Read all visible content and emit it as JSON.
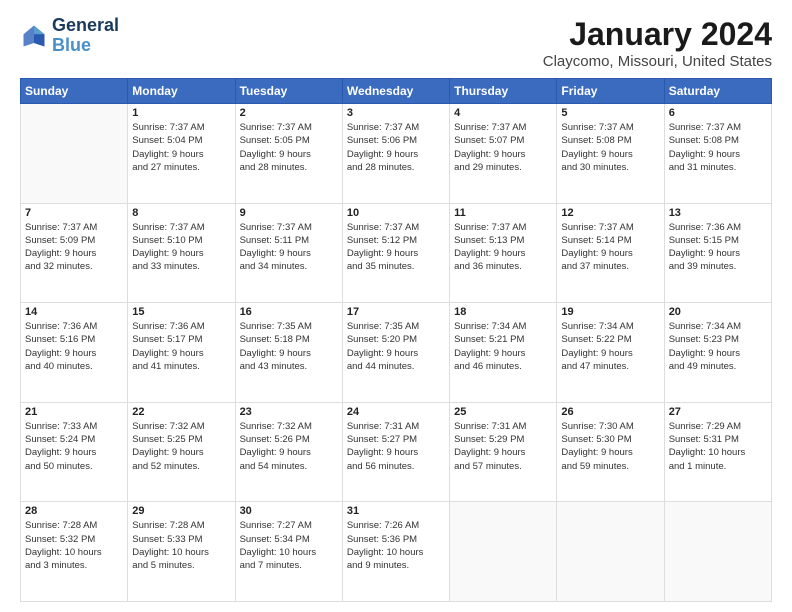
{
  "logo": {
    "line1": "General",
    "line2": "Blue"
  },
  "title": "January 2024",
  "subtitle": "Claycomo, Missouri, United States",
  "days_header": [
    "Sunday",
    "Monday",
    "Tuesday",
    "Wednesday",
    "Thursday",
    "Friday",
    "Saturday"
  ],
  "weeks": [
    [
      {
        "day": "",
        "info": ""
      },
      {
        "day": "1",
        "info": "Sunrise: 7:37 AM\nSunset: 5:04 PM\nDaylight: 9 hours\nand 27 minutes."
      },
      {
        "day": "2",
        "info": "Sunrise: 7:37 AM\nSunset: 5:05 PM\nDaylight: 9 hours\nand 28 minutes."
      },
      {
        "day": "3",
        "info": "Sunrise: 7:37 AM\nSunset: 5:06 PM\nDaylight: 9 hours\nand 28 minutes."
      },
      {
        "day": "4",
        "info": "Sunrise: 7:37 AM\nSunset: 5:07 PM\nDaylight: 9 hours\nand 29 minutes."
      },
      {
        "day": "5",
        "info": "Sunrise: 7:37 AM\nSunset: 5:08 PM\nDaylight: 9 hours\nand 30 minutes."
      },
      {
        "day": "6",
        "info": "Sunrise: 7:37 AM\nSunset: 5:08 PM\nDaylight: 9 hours\nand 31 minutes."
      }
    ],
    [
      {
        "day": "7",
        "info": "Sunrise: 7:37 AM\nSunset: 5:09 PM\nDaylight: 9 hours\nand 32 minutes."
      },
      {
        "day": "8",
        "info": "Sunrise: 7:37 AM\nSunset: 5:10 PM\nDaylight: 9 hours\nand 33 minutes."
      },
      {
        "day": "9",
        "info": "Sunrise: 7:37 AM\nSunset: 5:11 PM\nDaylight: 9 hours\nand 34 minutes."
      },
      {
        "day": "10",
        "info": "Sunrise: 7:37 AM\nSunset: 5:12 PM\nDaylight: 9 hours\nand 35 minutes."
      },
      {
        "day": "11",
        "info": "Sunrise: 7:37 AM\nSunset: 5:13 PM\nDaylight: 9 hours\nand 36 minutes."
      },
      {
        "day": "12",
        "info": "Sunrise: 7:37 AM\nSunset: 5:14 PM\nDaylight: 9 hours\nand 37 minutes."
      },
      {
        "day": "13",
        "info": "Sunrise: 7:36 AM\nSunset: 5:15 PM\nDaylight: 9 hours\nand 39 minutes."
      }
    ],
    [
      {
        "day": "14",
        "info": "Sunrise: 7:36 AM\nSunset: 5:16 PM\nDaylight: 9 hours\nand 40 minutes."
      },
      {
        "day": "15",
        "info": "Sunrise: 7:36 AM\nSunset: 5:17 PM\nDaylight: 9 hours\nand 41 minutes."
      },
      {
        "day": "16",
        "info": "Sunrise: 7:35 AM\nSunset: 5:18 PM\nDaylight: 9 hours\nand 43 minutes."
      },
      {
        "day": "17",
        "info": "Sunrise: 7:35 AM\nSunset: 5:20 PM\nDaylight: 9 hours\nand 44 minutes."
      },
      {
        "day": "18",
        "info": "Sunrise: 7:34 AM\nSunset: 5:21 PM\nDaylight: 9 hours\nand 46 minutes."
      },
      {
        "day": "19",
        "info": "Sunrise: 7:34 AM\nSunset: 5:22 PM\nDaylight: 9 hours\nand 47 minutes."
      },
      {
        "day": "20",
        "info": "Sunrise: 7:34 AM\nSunset: 5:23 PM\nDaylight: 9 hours\nand 49 minutes."
      }
    ],
    [
      {
        "day": "21",
        "info": "Sunrise: 7:33 AM\nSunset: 5:24 PM\nDaylight: 9 hours\nand 50 minutes."
      },
      {
        "day": "22",
        "info": "Sunrise: 7:32 AM\nSunset: 5:25 PM\nDaylight: 9 hours\nand 52 minutes."
      },
      {
        "day": "23",
        "info": "Sunrise: 7:32 AM\nSunset: 5:26 PM\nDaylight: 9 hours\nand 54 minutes."
      },
      {
        "day": "24",
        "info": "Sunrise: 7:31 AM\nSunset: 5:27 PM\nDaylight: 9 hours\nand 56 minutes."
      },
      {
        "day": "25",
        "info": "Sunrise: 7:31 AM\nSunset: 5:29 PM\nDaylight: 9 hours\nand 57 minutes."
      },
      {
        "day": "26",
        "info": "Sunrise: 7:30 AM\nSunset: 5:30 PM\nDaylight: 9 hours\nand 59 minutes."
      },
      {
        "day": "27",
        "info": "Sunrise: 7:29 AM\nSunset: 5:31 PM\nDaylight: 10 hours\nand 1 minute."
      }
    ],
    [
      {
        "day": "28",
        "info": "Sunrise: 7:28 AM\nSunset: 5:32 PM\nDaylight: 10 hours\nand 3 minutes."
      },
      {
        "day": "29",
        "info": "Sunrise: 7:28 AM\nSunset: 5:33 PM\nDaylight: 10 hours\nand 5 minutes."
      },
      {
        "day": "30",
        "info": "Sunrise: 7:27 AM\nSunset: 5:34 PM\nDaylight: 10 hours\nand 7 minutes."
      },
      {
        "day": "31",
        "info": "Sunrise: 7:26 AM\nSunset: 5:36 PM\nDaylight: 10 hours\nand 9 minutes."
      },
      {
        "day": "",
        "info": ""
      },
      {
        "day": "",
        "info": ""
      },
      {
        "day": "",
        "info": ""
      }
    ]
  ]
}
